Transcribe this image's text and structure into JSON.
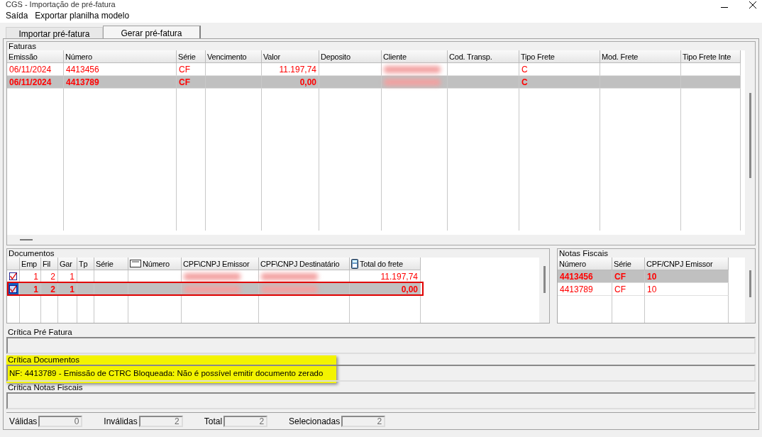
{
  "window": {
    "title": "CGS - Importação de pré-fatura"
  },
  "menu": [
    "Saída",
    "Exportar planilha modelo"
  ],
  "tabs": [
    {
      "label": "Importar pré-fatura",
      "selected": false
    },
    {
      "label": "Gerar pré-fatura",
      "selected": true
    }
  ],
  "faturas": {
    "title": "Faturas",
    "columns": [
      "Emissão",
      "Número",
      "Série",
      "Vencimento",
      "Valor",
      "Deposito",
      "Cliente",
      "Cod. Transp.",
      "Tipo Frete",
      "Mod. Frete",
      "Tipo Frete Inte"
    ],
    "rows": [
      {
        "selected": false,
        "redacted": true,
        "cells": [
          "06/11/2024",
          "4413456",
          "CF",
          "",
          "11.197,74",
          "",
          "",
          "",
          "C",
          "",
          ""
        ]
      },
      {
        "selected": true,
        "redacted": true,
        "cells": [
          "06/11/2024",
          "4413789",
          "CF",
          "",
          "0,00",
          "",
          "",
          "",
          "C",
          "",
          ""
        ]
      }
    ]
  },
  "documentos": {
    "title": "Documentos",
    "columns": [
      "",
      "Emp",
      "Fil",
      "Gar",
      "Tp",
      "Série",
      "Número",
      "CPF\\CNPJ Emissor",
      "CPF\\CNPJ Destinatário",
      "Total do frete"
    ],
    "rows": [
      {
        "selected": false,
        "checked": true,
        "redacted": true,
        "cells": [
          "",
          "1",
          "2",
          "1",
          "",
          "",
          "",
          "",
          "",
          "11.197,74"
        ]
      },
      {
        "selected": true,
        "checked": true,
        "redacted": true,
        "cells": [
          "",
          "1",
          "2",
          "1",
          "",
          "",
          "",
          "",
          "",
          "0,00"
        ]
      }
    ]
  },
  "notas": {
    "title": "Notas Fiscais",
    "columns": [
      "Número",
      "Série",
      "CPF/CNPJ Emissor"
    ],
    "rows": [
      {
        "selected": true,
        "cells": [
          "4413456",
          "CF",
          "10"
        ]
      },
      {
        "selected": false,
        "cells": [
          "4413789",
          "CF",
          "10"
        ]
      }
    ]
  },
  "criticas": [
    {
      "label": "Crítica Pré Fatura",
      "highlighted": false
    },
    {
      "label": "Crítica Documentos",
      "value": "NF: 4413789 - Emissão de CTRC Bloqueada: Não é possível emitir documento zerado",
      "highlighted": true
    },
    {
      "label": "Crítica Notas Fiscais",
      "highlighted": false
    }
  ],
  "status": [
    {
      "label": "Válidas",
      "value": "0"
    },
    {
      "label": "Inválidas",
      "value": "2"
    },
    {
      "label": "Total",
      "value": "2"
    },
    {
      "label": "Selecionadas",
      "value": "2"
    }
  ]
}
